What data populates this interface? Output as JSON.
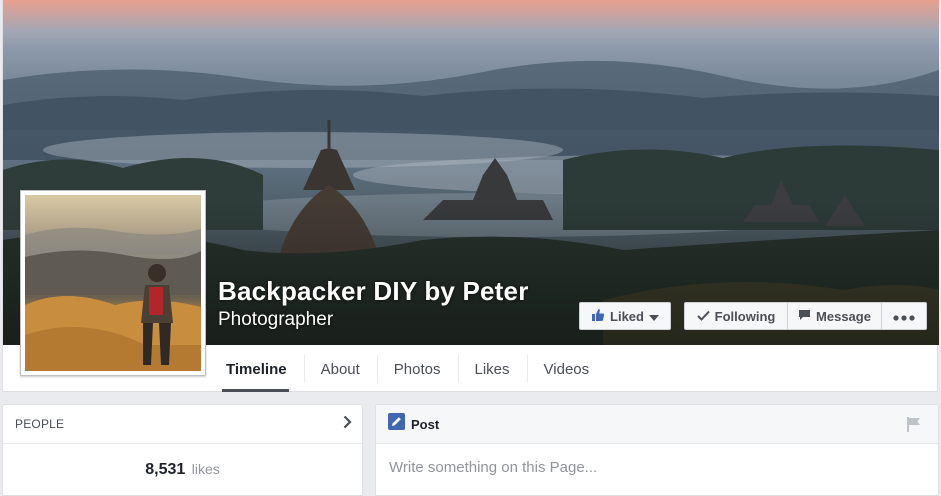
{
  "page": {
    "name": "Backpacker DIY by Peter",
    "category": "Photographer"
  },
  "actions": {
    "liked_label": "Liked",
    "following_label": "Following",
    "message_label": "Message"
  },
  "tabs": [
    {
      "label": "Timeline",
      "active": true
    },
    {
      "label": "About"
    },
    {
      "label": "Photos"
    },
    {
      "label": "Likes"
    },
    {
      "label": "Videos"
    }
  ],
  "people": {
    "title": "PEOPLE",
    "count": "8,531",
    "count_unit": "likes"
  },
  "composer": {
    "post_label": "Post",
    "placeholder": "Write something on this Page..."
  },
  "icons": {
    "liked": "thumbs-up-icon",
    "following": "checkmark-icon",
    "message": "speech-bubble-icon",
    "more": "ellipsis-icon",
    "people_chevron": "chevron-right-icon",
    "post": "pencil-icon",
    "flag": "flag-icon"
  },
  "colors": {
    "accent": "#4267b2",
    "text": "#1d2129",
    "muted": "#90949c"
  }
}
